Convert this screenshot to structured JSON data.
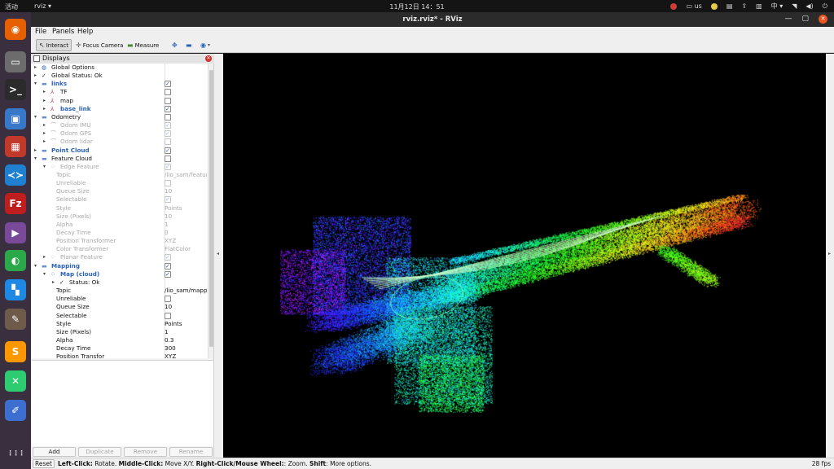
{
  "topbar": {
    "activities": "活动",
    "app_menu": "rviz ▾",
    "clock": "11月12日  14：51",
    "input_method": "us",
    "lang": "中 ▾"
  },
  "window": {
    "title": "rviz.rviz* - RViz"
  },
  "menu": {
    "file": "File",
    "panels": "Panels",
    "help": "Help"
  },
  "toolbar": {
    "interact": "Interact",
    "focus_camera": "Focus Camera",
    "measure": "Measure"
  },
  "displays": {
    "title": "Displays",
    "rows": [
      {
        "name": "Global Options",
        "indent": 0,
        "arrow": "▸",
        "icon": "globe-icon",
        "glyph": "◍",
        "color": "#2a62b8"
      },
      {
        "name": "Global Status: Ok",
        "indent": 0,
        "arrow": "▸",
        "icon": "check-icon",
        "glyph": "✓",
        "color": "#222"
      },
      {
        "name": "links",
        "indent": 0,
        "arrow": "▾",
        "icon": "folder-icon",
        "glyph": "▬",
        "color": "#6b8fd0",
        "check": true,
        "blue": true
      },
      {
        "name": "TF",
        "indent": 1,
        "arrow": "▸",
        "icon": "tf-icon",
        "glyph": "⅄",
        "color": "#c03050",
        "check": false
      },
      {
        "name": "map",
        "indent": 1,
        "arrow": "▸",
        "icon": "axes-icon",
        "glyph": "⅄",
        "color": "#c03050",
        "check": false
      },
      {
        "name": "base_link",
        "indent": 1,
        "arrow": "▸",
        "icon": "axes-icon",
        "glyph": "⅄",
        "color": "#c03050",
        "check": true,
        "blue": true
      },
      {
        "name": "Odometry",
        "indent": 0,
        "arrow": "▾",
        "icon": "folder-icon",
        "glyph": "▬",
        "color": "#6b8fd0",
        "check": false
      },
      {
        "name": "Odom IMU",
        "indent": 1,
        "arrow": "▸",
        "icon": "odometry-icon",
        "glyph": "⌒",
        "color": "#a8a8a8",
        "check": true,
        "disabled": true
      },
      {
        "name": "Odom GPS",
        "indent": 1,
        "arrow": "▸",
        "icon": "odometry-icon",
        "glyph": "⌒",
        "color": "#a8a8a8",
        "check": true,
        "disabled": true
      },
      {
        "name": "Odom lidar",
        "indent": 1,
        "arrow": "▸",
        "icon": "odometry-icon",
        "glyph": "⌒",
        "color": "#a8a8a8",
        "check": false,
        "disabled": true
      },
      {
        "name": "Point Cloud",
        "indent": 0,
        "arrow": "▸",
        "icon": "folder-icon",
        "glyph": "▬",
        "color": "#6b8fd0",
        "check": true,
        "blue": true
      },
      {
        "name": "Feature Cloud",
        "indent": 0,
        "arrow": "▾",
        "icon": "folder-icon",
        "glyph": "▬",
        "color": "#6b8fd0",
        "check": false
      },
      {
        "name": "Edge Feature",
        "indent": 1,
        "arrow": "▾",
        "icon": "pointcloud-icon",
        "glyph": "⁘",
        "color": "#a8a8a8",
        "check": true,
        "disabled": true
      },
      {
        "name": "Topic",
        "indent": 2,
        "value": "/lio_sam/feature/clou...",
        "disabled": true
      },
      {
        "name": "Unreliable",
        "indent": 2,
        "check": false,
        "disabled": true
      },
      {
        "name": "Queue Size",
        "indent": 2,
        "value": "10",
        "disabled": true
      },
      {
        "name": "Selectable",
        "indent": 2,
        "check": true,
        "disabled": true
      },
      {
        "name": "Style",
        "indent": 2,
        "value": "Points",
        "disabled": true
      },
      {
        "name": "Size (Pixels)",
        "indent": 2,
        "value": "10",
        "disabled": true
      },
      {
        "name": "Alpha",
        "indent": 2,
        "value": "1",
        "disabled": true
      },
      {
        "name": "Decay Time",
        "indent": 2,
        "value": "0",
        "disabled": true
      },
      {
        "name": "Position Transformer",
        "indent": 2,
        "value": "XYZ",
        "disabled": true
      },
      {
        "name": "Color Transformer",
        "indent": 2,
        "value": "FlatColor",
        "disabled": true
      },
      {
        "name": "Planar Feature",
        "indent": 1,
        "arrow": "▸",
        "icon": "pointcloud-icon",
        "glyph": "⁘",
        "color": "#a8a8a8",
        "check": true,
        "disabled": true
      },
      {
        "name": "Mapping",
        "indent": 0,
        "arrow": "▾",
        "icon": "folder-icon",
        "glyph": "▬",
        "color": "#6b8fd0",
        "check": true,
        "blue": true
      },
      {
        "name": "Map (cloud)",
        "indent": 1,
        "arrow": "▾",
        "icon": "pointcloud-icon",
        "glyph": "⁘",
        "color": "#2a62b8",
        "check": true,
        "blue": true
      },
      {
        "name": "Status: Ok",
        "indent": 2,
        "arrow": "▸",
        "icon": "check-icon",
        "glyph": "✓",
        "color": "#222"
      },
      {
        "name": "Topic",
        "indent": 2,
        "value": "/lio_sam/mapping/clo..."
      },
      {
        "name": "Unreliable",
        "indent": 2,
        "check": false
      },
      {
        "name": "Queue Size",
        "indent": 2,
        "value": "10"
      },
      {
        "name": "Selectable",
        "indent": 2,
        "check": false
      },
      {
        "name": "Style",
        "indent": 2,
        "value": "Points"
      },
      {
        "name": "Size (Pixels)",
        "indent": 2,
        "value": "1"
      },
      {
        "name": "Alpha",
        "indent": 2,
        "value": "0.3"
      },
      {
        "name": "Decay Time",
        "indent": 2,
        "value": "300"
      },
      {
        "name": "Position Transfor",
        "indent": 2,
        "value": "XYZ"
      }
    ],
    "buttons": {
      "add": "Add",
      "duplicate": "Duplicate",
      "remove": "Remove",
      "rename": "Rename"
    }
  },
  "statusbar": {
    "reset": "Reset",
    "hint_left_b": "Left-Click:",
    "hint_left": " Rotate. ",
    "hint_middle_b": "Middle-Click:",
    "hint_middle": " Move X/Y. ",
    "hint_right_b": "Right-Click/Mouse Wheel:",
    "hint_right": ": Zoom. ",
    "hint_shift_b": "Shift",
    "hint_shift": ": More options.",
    "fps": "28 fps"
  },
  "dock_apps": [
    {
      "icon": "firefox-icon",
      "color": "#e66000",
      "glyph": "◉"
    },
    {
      "icon": "files-icon",
      "color": "#6c6c6c",
      "glyph": "▭"
    },
    {
      "icon": "terminal-icon",
      "color": "#2b2b2b",
      "glyph": ">_"
    },
    {
      "icon": "screenshot-icon",
      "color": "#3878c8",
      "glyph": "▣"
    },
    {
      "icon": "presentation-icon",
      "color": "#c0392b",
      "glyph": "▦"
    },
    {
      "icon": "vscode-icon",
      "color": "#1f7fd0",
      "glyph": "≺≻"
    },
    {
      "icon": "filezilla-icon",
      "color": "#bf1e1e",
      "glyph": "Fz"
    },
    {
      "icon": "video-icon",
      "color": "#7a4a9a",
      "glyph": "▶"
    },
    {
      "icon": "aim-icon",
      "color": "#2aa84a",
      "glyph": "◐"
    },
    {
      "icon": "todesk-icon",
      "color": "#1e88e5",
      "glyph": "▚"
    },
    {
      "icon": "gimp-icon",
      "color": "#6e5b4a",
      "glyph": "✎"
    },
    {
      "icon": "sublime-icon",
      "color": "#ff9800",
      "glyph": "S"
    },
    {
      "icon": "xmind-icon",
      "color": "#2ecc71",
      "glyph": "✕"
    },
    {
      "icon": "editor-icon",
      "color": "#3d6fd0",
      "glyph": "✐"
    },
    {
      "icon": "apps-grid-icon",
      "color": "transparent",
      "glyph": "⋮⋮⋮"
    }
  ]
}
